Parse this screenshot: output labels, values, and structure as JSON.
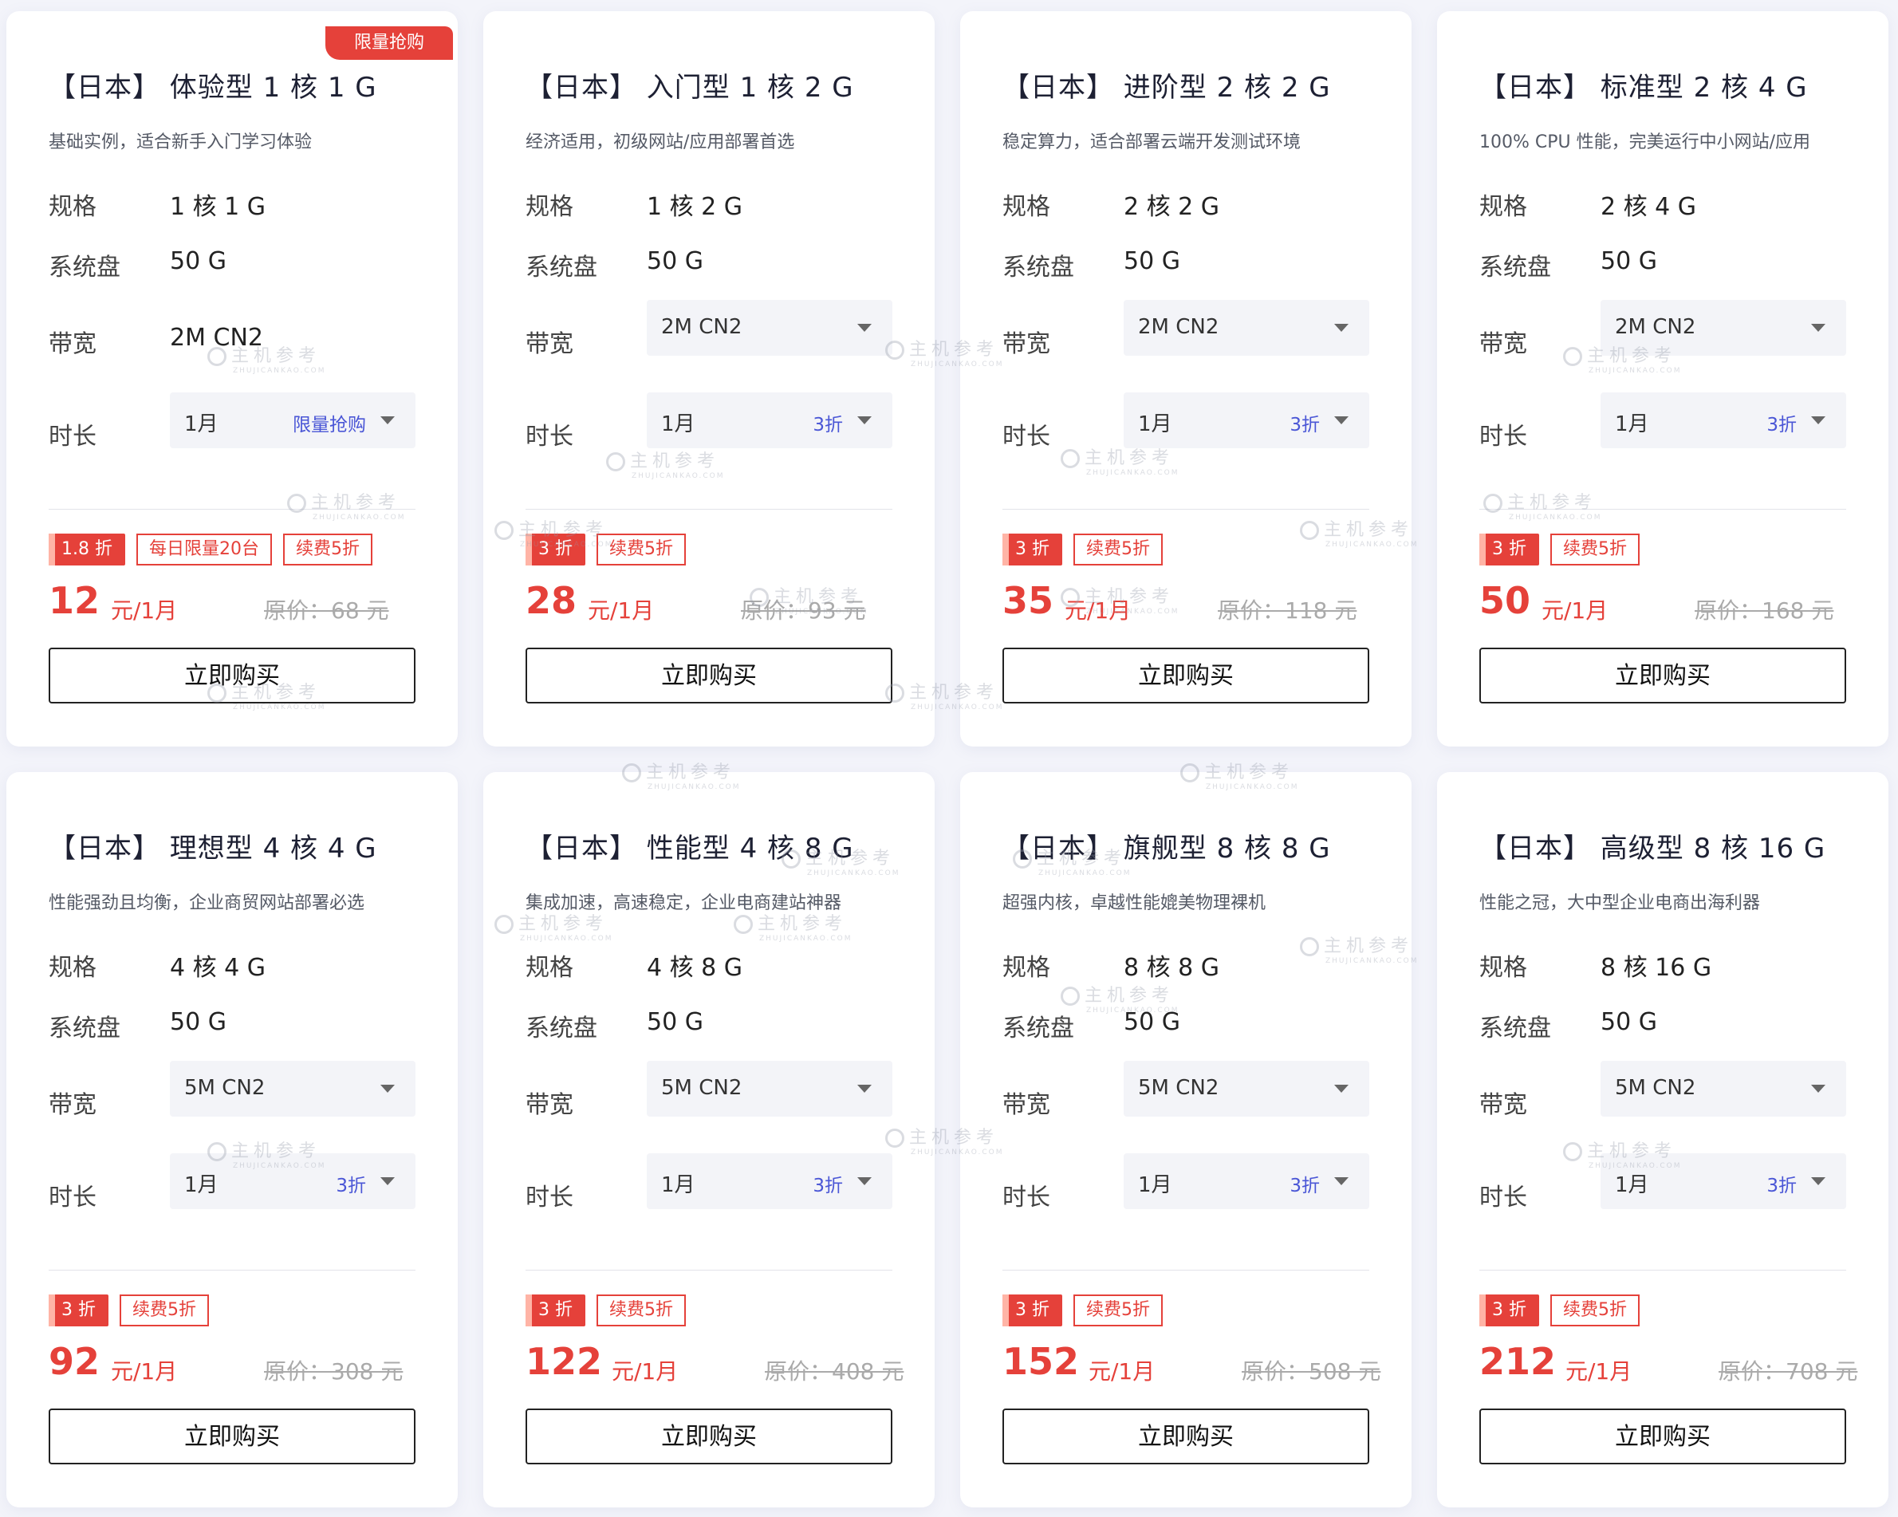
{
  "watermark": {
    "text": "主机参考",
    "sub": "ZHUJICANKAO.COM"
  },
  "labels": {
    "spec": "规格",
    "disk": "系统盘",
    "bandwidth": "带宽",
    "duration": "时长",
    "buy": "立即购买"
  },
  "cards": [
    {
      "corner_badge": "限量抢购",
      "title": "【日本】 体验型 1 核 1 G",
      "desc": "基础实例，适合新手入门学习体验",
      "spec": "1 核 1 G",
      "disk": "50 G",
      "bandwidth": "2M CN2",
      "duration": "1月",
      "duration_tag": "限量抢购",
      "discount": "1.8 折",
      "tag2": "每日限量20台",
      "tag3": "续费5折",
      "price": "12",
      "price_unit": "元/1月",
      "orig": "原价：68 元"
    },
    {
      "title": "【日本】 入门型 1 核 2 G",
      "desc": "经济适用，初级网站/应用部署首选",
      "spec": "1 核 2 G",
      "disk": "50 G",
      "bandwidth": "2M CN2",
      "duration": "1月",
      "duration_tag": "3折",
      "discount": "3 折",
      "tag3": "续费5折",
      "price": "28",
      "price_unit": "元/1月",
      "orig": "原价：93 元"
    },
    {
      "title": "【日本】 进阶型 2 核 2 G",
      "desc": "稳定算力，适合部署云端开发测试环境",
      "spec": "2 核 2 G",
      "disk": "50 G",
      "bandwidth": "2M CN2",
      "duration": "1月",
      "duration_tag": "3折",
      "discount": "3 折",
      "tag3": "续费5折",
      "price": "35",
      "price_unit": "元/1月",
      "orig": "原价：118 元"
    },
    {
      "title": "【日本】 标准型 2 核 4 G",
      "desc": "100% CPU 性能，完美运行中小网站/应用",
      "spec": "2 核 4 G",
      "disk": "50 G",
      "bandwidth": "2M CN2",
      "duration": "1月",
      "duration_tag": "3折",
      "discount": "3 折",
      "tag3": "续费5折",
      "price": "50",
      "price_unit": "元/1月",
      "orig": "原价：168 元"
    },
    {
      "title": "【日本】 理想型 4 核 4 G",
      "desc": "性能强劲且均衡，企业商贸网站部署必选",
      "spec": "4 核 4 G",
      "disk": "50 G",
      "bandwidth": "5M CN2",
      "duration": "1月",
      "duration_tag": "3折",
      "discount": "3 折",
      "tag3": "续费5折",
      "price": "92",
      "price_unit": "元/1月",
      "orig": "原价：308 元"
    },
    {
      "title": "【日本】 性能型 4 核 8 G",
      "desc": "集成加速，高速稳定，企业电商建站神器",
      "spec": "4 核 8 G",
      "disk": "50 G",
      "bandwidth": "5M CN2",
      "duration": "1月",
      "duration_tag": "3折",
      "discount": "3 折",
      "tag3": "续费5折",
      "price": "122",
      "price_unit": "元/1月",
      "orig": "原价：408 元"
    },
    {
      "title": "【日本】 旗舰型 8 核 8 G",
      "desc": "超强内核，卓越性能媲美物理裸机",
      "spec": "8 核 8 G",
      "disk": "50 G",
      "bandwidth": "5M CN2",
      "duration": "1月",
      "duration_tag": "3折",
      "discount": "3 折",
      "tag3": "续费5折",
      "price": "152",
      "price_unit": "元/1月",
      "orig": "原价：508 元"
    },
    {
      "title": "【日本】 高级型 8 核 16 G",
      "desc": "性能之冠，大中型企业电商出海利器",
      "spec": "8 核 16 G",
      "disk": "50 G",
      "bandwidth": "5M CN2",
      "duration": "1月",
      "duration_tag": "3折",
      "discount": "3 折",
      "tag3": "续费5折",
      "price": "212",
      "price_unit": "元/1月",
      "orig": "原价：708 元"
    }
  ]
}
